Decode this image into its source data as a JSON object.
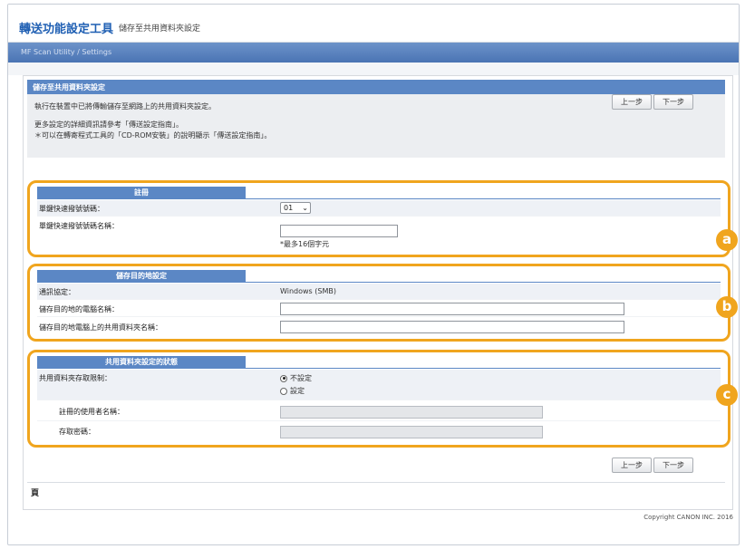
{
  "header": {
    "title": "轉送功能設定工具",
    "subtitle": "儲存至共用資料夾設定"
  },
  "breadcrumb": "MF Scan Utility / Settings",
  "intro": {
    "banner": "儲存至共用資料夾設定",
    "lines": [
      "執行在裝置中已將傳輸儲存至網路上的共用資料夾設定。",
      "更多設定的詳細資訊請參考「傳送設定指南」。",
      "＊可以在轉寄程式工具的「CD-ROM安裝」的說明顯示「傳送設定指南」。"
    ]
  },
  "nav": {
    "back_label": "上一步",
    "next_label": "下一步"
  },
  "groups": {
    "register": {
      "title": "註冊",
      "coded_dial_label": "單鍵快速撥號號碼：",
      "coded_dial_value": "01",
      "coded_dial_name_label": "單鍵快速撥號號碼名稱：",
      "name_value": "",
      "name_hint": "*最多16個字元"
    },
    "destination": {
      "title": "儲存目的地設定",
      "protocol_label": "通訊協定：",
      "protocol_value": "Windows (SMB)",
      "host_label": "儲存目的地的電腦名稱：",
      "host_value": "",
      "folder_label": "儲存目的地電腦上的共用資料夾名稱：",
      "folder_value": ""
    },
    "status": {
      "title": "共用資料夾設定的狀態",
      "restriction_label": "共用資料夾存取限制：",
      "option_not_set": "不設定",
      "option_set": "設定",
      "selected": "不設定",
      "username_label": "註冊的使用者名稱：",
      "password_label": "存取密碼："
    }
  },
  "badges": [
    "a",
    "b",
    "c"
  ],
  "page_end_mark": "頁",
  "copyright": "Copyright CANON INC. 2016",
  "colors": {
    "accent": "#5b87c5",
    "highlight": "#f0a51e",
    "title": "#1f5fb3"
  }
}
